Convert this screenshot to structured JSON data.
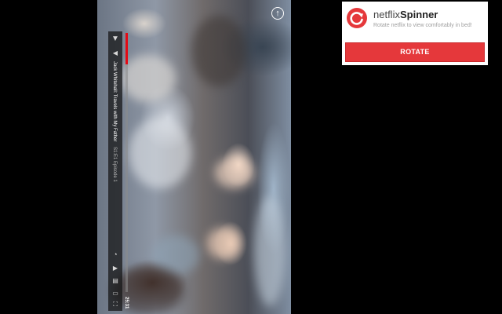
{
  "extension": {
    "brand_prefix": "netflix",
    "brand_name": "Spinner",
    "tagline": "Rotate netflix to view comfortably in bed!",
    "rotate_label": "ROTATE",
    "accent_color": "#e5383b"
  },
  "player": {
    "title": "Jack Whitehall: Travels with My Father",
    "episode": "S1:E1  Episode 1",
    "elapsed": "25:31",
    "progress_fraction": 0.12,
    "progress_color": "#e50914",
    "icons": {
      "back": "back-arrow-icon",
      "volume": "volume-icon",
      "upload": "upload-arrow-icon",
      "audio_subtitles": "audio-subtitles-icon",
      "next_episode": "next-episode-icon",
      "episodes": "episodes-icon",
      "fullscreen": "fullscreen-icon",
      "speed": "speed-icon"
    }
  }
}
